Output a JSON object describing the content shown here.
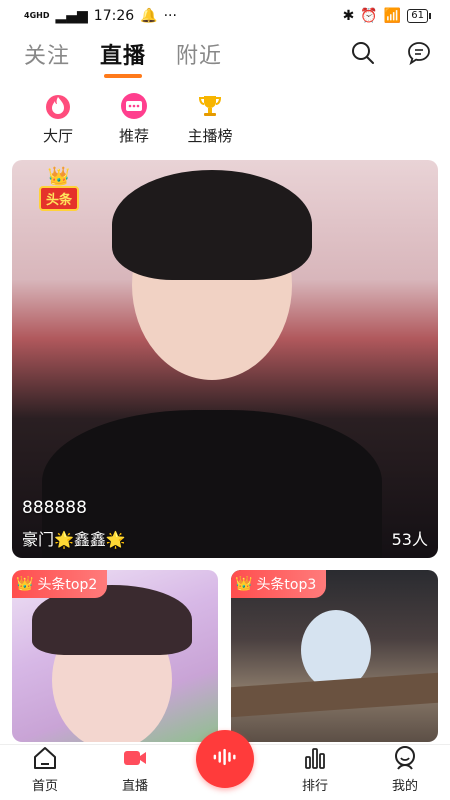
{
  "status": {
    "time": "17:26",
    "network": "4GHD",
    "battery": "61"
  },
  "tabs": [
    {
      "label": "关注"
    },
    {
      "label": "直播"
    },
    {
      "label": "附近"
    }
  ],
  "quick_links": [
    {
      "label": "大厅",
      "icon": "flame-icon"
    },
    {
      "label": "推荐",
      "icon": "chat-badge-icon"
    },
    {
      "label": "主播榜",
      "icon": "trophy-icon"
    }
  ],
  "featured": {
    "badge": "头条",
    "id_text": "888888",
    "name": "豪门🌟鑫鑫🌟",
    "viewers": "53人"
  },
  "cards": [
    {
      "badge": "头条top2"
    },
    {
      "badge": "头条top3"
    }
  ],
  "bottom_nav": [
    {
      "label": "首页"
    },
    {
      "label": "直播"
    },
    {
      "label": ""
    },
    {
      "label": "排行"
    },
    {
      "label": "我的"
    }
  ],
  "colors": {
    "accent": "#ff7a1a",
    "live_red": "#ff3b3b",
    "badge_red": "#ff4e4e"
  }
}
